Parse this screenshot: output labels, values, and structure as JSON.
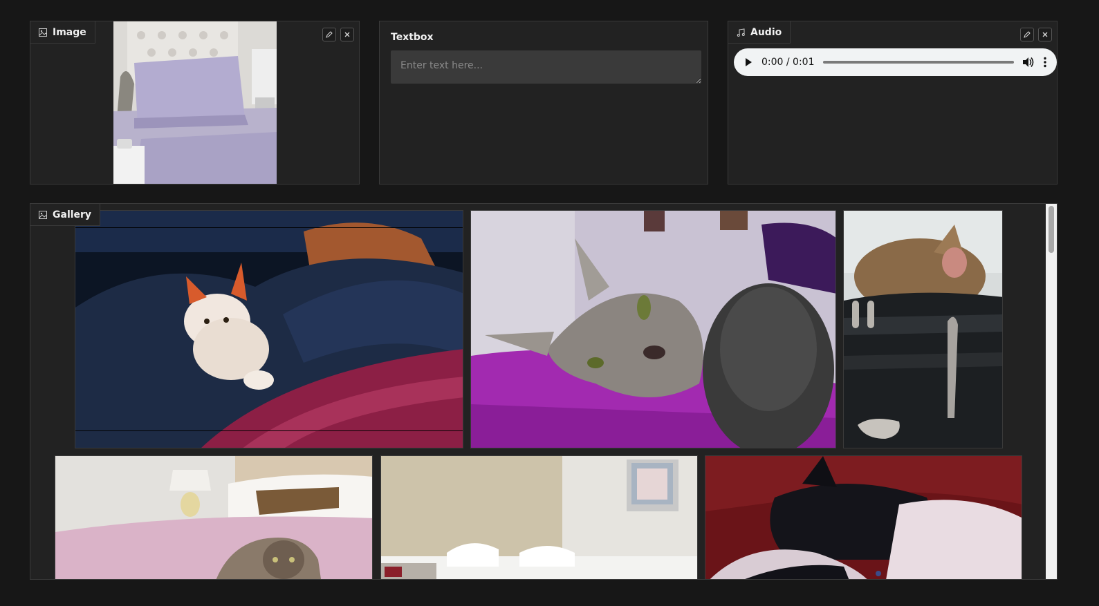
{
  "image_panel": {
    "label": "Image",
    "icon": "image-icon",
    "edit_icon": "pencil-icon",
    "clear_icon": "close-icon"
  },
  "textbox_panel": {
    "label": "Textbox",
    "placeholder": "Enter text here...",
    "value": ""
  },
  "audio_panel": {
    "label": "Audio",
    "icon": "music-note-icon",
    "time": "0:00 / 0:01",
    "progress": 0,
    "edit_icon": "pencil-icon",
    "clear_icon": "close-icon"
  },
  "gallery_panel": {
    "label": "Gallery",
    "icon": "image-icon",
    "items": [
      "cat-on-navy-duvet-and-magenta-pillow",
      "tabby-cat-on-purple-bedsheet",
      "cat-sitting-on-black-suitcase",
      "siamese-cat-on-pink-bed",
      "hotel-room-white-bed",
      "black-and-white-cat-on-red-blanket"
    ]
  },
  "colors": {
    "page_bg": "#171717",
    "panel_bg": "#222222",
    "border": "#3a3a3a",
    "input_bg": "#3a3a3a"
  }
}
